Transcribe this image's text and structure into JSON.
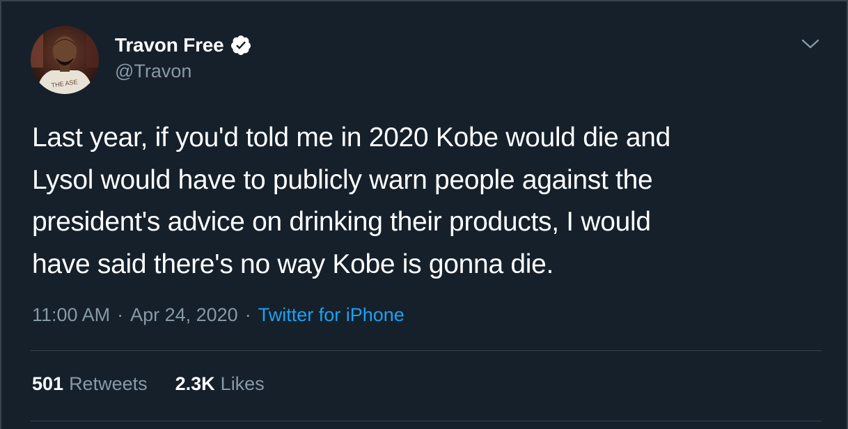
{
  "tweet": {
    "author": {
      "display_name": "Travon Free",
      "handle": "@Travon",
      "verified": true
    },
    "text": "Last year, if you'd told me in 2020 Kobe would die and\nLysol would have to publicly warn people against the\npresident's advice on drinking their products, I would\nhave said there's no way Kobe is gonna die.",
    "time": "11:00 AM",
    "date": "Apr 24, 2020",
    "separator": "·",
    "source": "Twitter for iPhone",
    "stats": {
      "retweets_count": "501",
      "retweets_label": "Retweets",
      "likes_count": "2.3K",
      "likes_label": "Likes"
    },
    "avatar_shirt_text": "THE ASE"
  },
  "icons": {
    "verified": "verified-badge-icon",
    "menu": "chevron-down-icon"
  },
  "colors": {
    "background": "#15202b",
    "text_primary": "#ffffff",
    "text_secondary": "#8899a6",
    "accent": "#1da1f2",
    "border": "#38444d"
  }
}
